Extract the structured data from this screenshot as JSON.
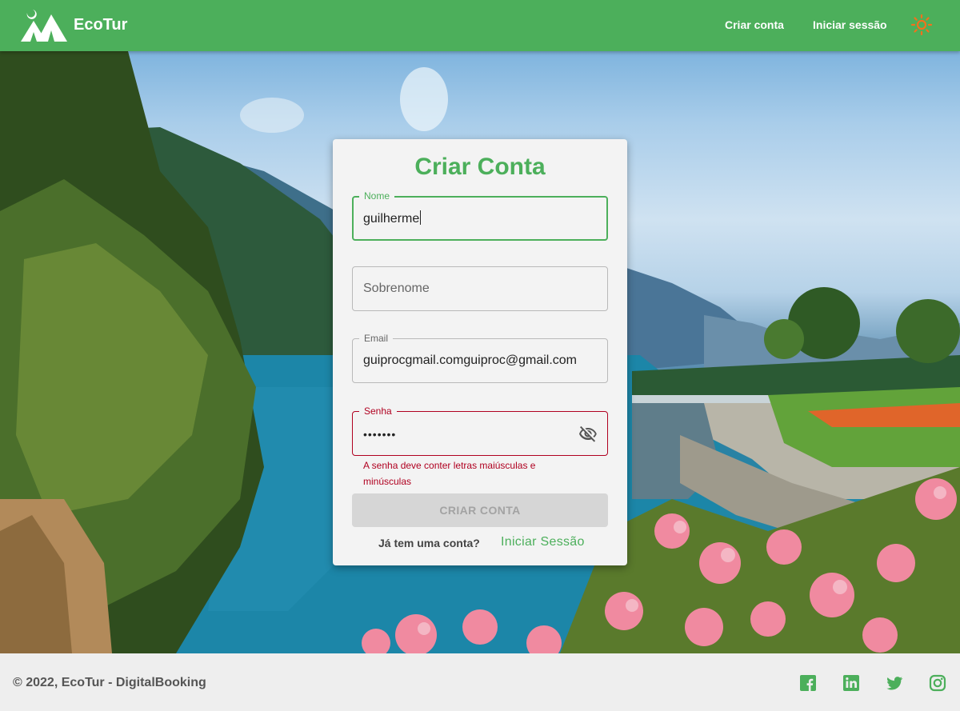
{
  "header": {
    "brand": "EcoTur",
    "nav": {
      "create_account": "Criar conta",
      "login": "Iniciar sessão"
    },
    "icons": {
      "logo": "tent-moon-logo-icon",
      "theme_toggle": "sun-icon"
    },
    "colors": {
      "primary": "#4caf5b",
      "sun": "#f2711c"
    }
  },
  "form": {
    "title": "Criar Conta",
    "fields": {
      "nome": {
        "label": "Nome",
        "value": "guilherme"
      },
      "sobrenome": {
        "placeholder": "Sobrenome",
        "value": ""
      },
      "email": {
        "label": "Email",
        "value": "guiprocgmail.comguiproc@gmail.com"
      },
      "senha": {
        "label": "Senha",
        "value": "•••••••",
        "error": "A senha deve conter letras maiúsculas e minúsculas"
      }
    },
    "submit_label": "CRIAR CONTA",
    "have_account": "Já tem uma conta?",
    "login_link": "Iniciar Sessão",
    "colors": {
      "error": "#b00020"
    }
  },
  "footer": {
    "copyright": "© 2022, EcoTur - DigitalBooking",
    "social": [
      "facebook-icon",
      "linkedin-icon",
      "twitter-icon",
      "instagram-icon"
    ]
  }
}
